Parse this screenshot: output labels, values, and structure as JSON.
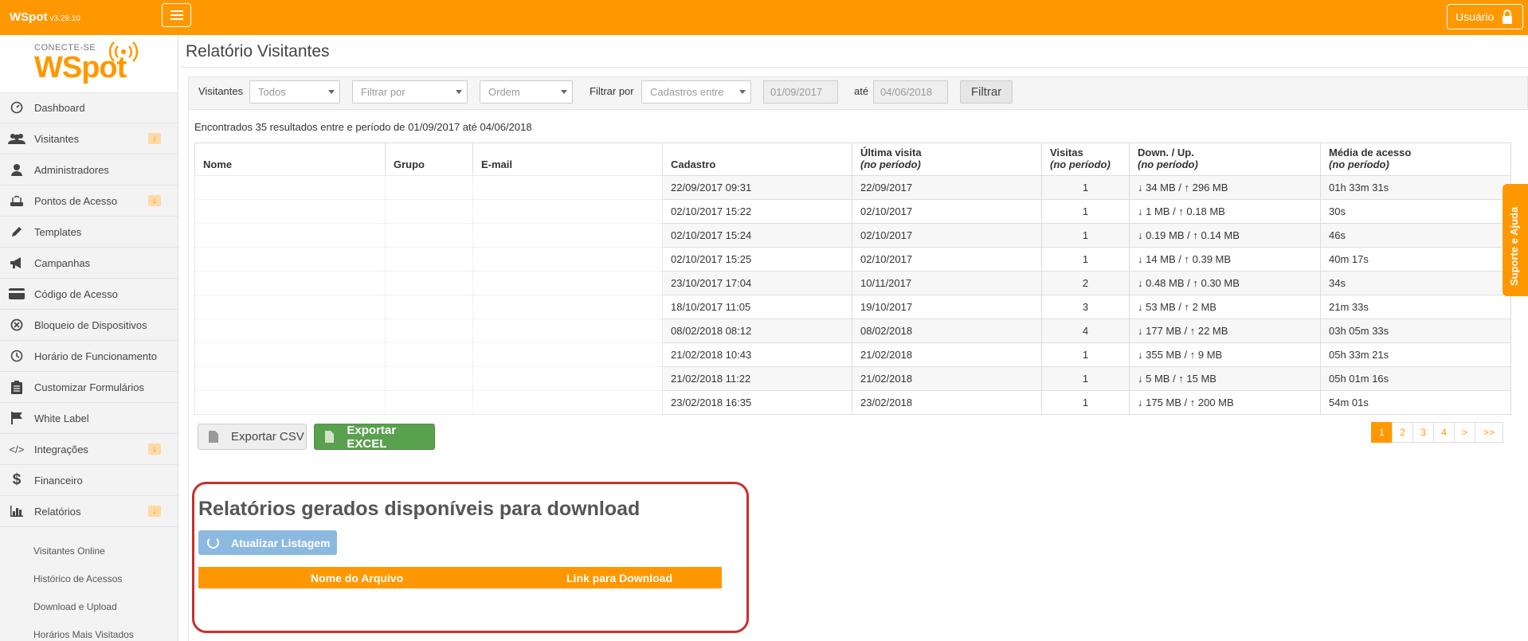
{
  "topbar": {
    "brand": "WSpot",
    "version": "v3.29.10",
    "user_label": "Usuário"
  },
  "logo": {
    "tagline": "CONECTE-SE",
    "name": "WSpot"
  },
  "sidebar": {
    "items": [
      {
        "label": "Dashboard",
        "icon": "dashboard-icon"
      },
      {
        "label": "Visitantes",
        "icon": "users-icon",
        "expandable": true
      },
      {
        "label": "Administradores",
        "icon": "user-icon"
      },
      {
        "label": "Pontos de Acesso",
        "icon": "router-icon",
        "expandable": true
      },
      {
        "label": "Templates",
        "icon": "pencil-icon"
      },
      {
        "label": "Campanhas",
        "icon": "megaphone-icon"
      },
      {
        "label": "Código de Acesso",
        "icon": "card-icon"
      },
      {
        "label": "Bloqueio de Dispositivos",
        "icon": "block-icon"
      },
      {
        "label": "Horário de Funcionamento",
        "icon": "clock-icon"
      },
      {
        "label": "Customizar Formulários",
        "icon": "clipboard-icon"
      },
      {
        "label": "White Label",
        "icon": "flag-icon"
      },
      {
        "label": "Integrações",
        "icon": "code-icon",
        "expandable": true
      },
      {
        "label": "Financeiro",
        "icon": "dollar-icon"
      },
      {
        "label": "Relatórios",
        "icon": "bar-chart-icon",
        "expandable": true
      }
    ],
    "sub_items": [
      "Visitantes Online",
      "Histórico de Acessos",
      "Download e Upload",
      "Horários Mais Visitados"
    ]
  },
  "page": {
    "title": "Relatório Visitantes"
  },
  "filters": {
    "visitantes_label": "Visitantes",
    "visitantes_value": "Todos",
    "filtrar_por_placeholder": "Filtrar por",
    "ordem_placeholder": "Ordem",
    "filtrar_por_label": "Filtrar por",
    "periodo_value": "Cadastros entre",
    "date_from": "01/09/2017",
    "ate_label": "até",
    "date_to": "04/06/2018",
    "submit_label": "Filtrar"
  },
  "results_text": "Encontrados 35 resultados entre e período de 01/09/2017 até 04/06/2018",
  "table": {
    "headers": {
      "nome": "Nome",
      "grupo": "Grupo",
      "email": "E-mail",
      "cadastro": "Cadastro",
      "ultima": "Última visita",
      "visitas": "Visitas",
      "down_up": "Down. / Up.",
      "media": "Média de acesso",
      "sub": "(no período)"
    },
    "rows": [
      {
        "nome": "",
        "grupo": "",
        "email": "",
        "cadastro": "22/09/2017 09:31",
        "ultima": "22/09/2017",
        "visitas": "1",
        "down": "↓ 34 MB / ↑ 296 MB",
        "media": "01h 33m 31s"
      },
      {
        "nome": "",
        "grupo": "",
        "email": "",
        "cadastro": "02/10/2017 15:22",
        "ultima": "02/10/2017",
        "visitas": "1",
        "down": "↓ 1 MB / ↑ 0.18 MB",
        "media": "30s"
      },
      {
        "nome": "",
        "grupo": "",
        "email": "",
        "cadastro": "02/10/2017 15:24",
        "ultima": "02/10/2017",
        "visitas": "1",
        "down": "↓ 0.19 MB / ↑ 0.14 MB",
        "media": "46s"
      },
      {
        "nome": "",
        "grupo": "",
        "email": "",
        "cadastro": "02/10/2017 15:25",
        "ultima": "02/10/2017",
        "visitas": "1",
        "down": "↓ 14 MB / ↑ 0.39 MB",
        "media": "40m 17s"
      },
      {
        "nome": "",
        "grupo": "",
        "email": "",
        "cadastro": "23/10/2017 17:04",
        "ultima": "10/11/2017",
        "visitas": "2",
        "down": "↓ 0.48 MB / ↑ 0.30 MB",
        "media": "34s"
      },
      {
        "nome": "",
        "grupo": "",
        "email": "",
        "cadastro": "18/10/2017 11:05",
        "ultima": "19/10/2017",
        "visitas": "3",
        "down": "↓ 53 MB / ↑ 2 MB",
        "media": "21m 33s"
      },
      {
        "nome": "",
        "grupo": "",
        "email": "",
        "cadastro": "08/02/2018 08:12",
        "ultima": "08/02/2018",
        "visitas": "4",
        "down": "↓ 177 MB / ↑ 22 MB",
        "media": "03h 05m 33s"
      },
      {
        "nome": "",
        "grupo": "",
        "email": "",
        "cadastro": "21/02/2018 10:43",
        "ultima": "21/02/2018",
        "visitas": "1",
        "down": "↓ 355 MB / ↑ 9 MB",
        "media": "05h 33m 21s"
      },
      {
        "nome": "",
        "grupo": "",
        "email": "",
        "cadastro": "21/02/2018 11:22",
        "ultima": "21/02/2018",
        "visitas": "1",
        "down": "↓ 5 MB / ↑ 15 MB",
        "media": "05h 01m 16s"
      },
      {
        "nome": "",
        "grupo": "",
        "email": "",
        "cadastro": "23/02/2018 16:35",
        "ultima": "23/02/2018",
        "visitas": "1",
        "down": "↓ 175 MB / ↑ 200 MB",
        "media": "54m 01s"
      }
    ]
  },
  "export": {
    "csv_label": "Exportar CSV",
    "excel_label": "Exportar EXCEL"
  },
  "pagination": [
    "1",
    "2",
    "3",
    "4",
    ">",
    ">>"
  ],
  "downloads": {
    "title": "Relatórios gerados disponíveis para download",
    "refresh_label": "Atualizar Listagem",
    "col_file": "Nome do Arquivo",
    "col_link": "Link para Download"
  },
  "support_tab": "Suporte e Ajuda",
  "colors": {
    "brand": "#ff9800",
    "excel": "#5aa14f",
    "highlight": "#c9302c",
    "refresh": "#8cb9e0"
  }
}
